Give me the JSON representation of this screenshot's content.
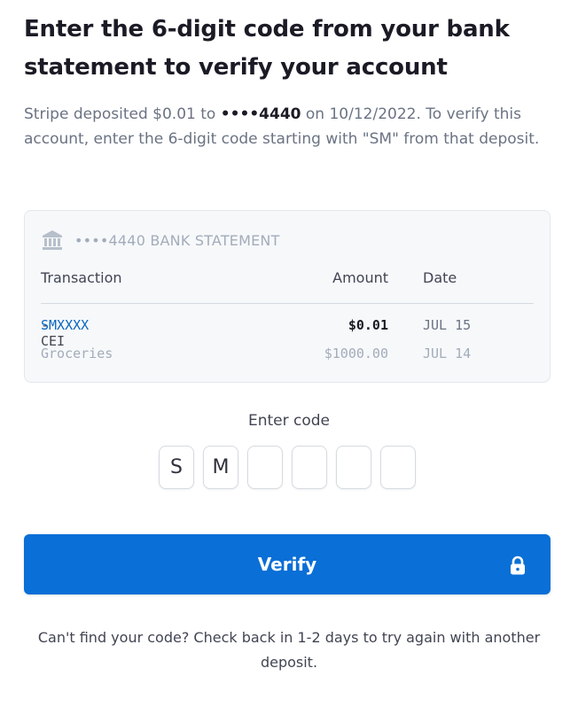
{
  "title": "Enter the 6-digit code from your bank statement to verify your account",
  "description": {
    "prefix": "Stripe deposited $0.01 to ",
    "account_mask": "••••4440",
    "suffix": " on 10/12/2022. To verify this account, enter the 6-digit code starting with \"SM\" from that deposit."
  },
  "statement": {
    "header": "••••4440 BANK STATEMENT",
    "columns": {
      "transaction": "Transaction",
      "amount": "Amount",
      "date": "Date"
    },
    "rows": [
      {
        "code_highlight": "SMXXXX",
        "code_rest": "-CEI",
        "amount": "$0.01",
        "date": "JUL 15"
      },
      {
        "description": "Groceries",
        "amount": "$1000.00",
        "date": "JUL 14"
      }
    ]
  },
  "code_entry": {
    "label": "Enter code",
    "digits": [
      "S",
      "M",
      "",
      "",
      "",
      ""
    ]
  },
  "verify_button": {
    "label": "Verify"
  },
  "footer": "Can't find your code? Check back in 1-2 days to try again with another deposit.",
  "icons": {
    "bank": "bank-icon",
    "lock": "lock-icon"
  },
  "colors": {
    "accent": "#0a6fd6",
    "code_highlight": "#0a66c2"
  }
}
